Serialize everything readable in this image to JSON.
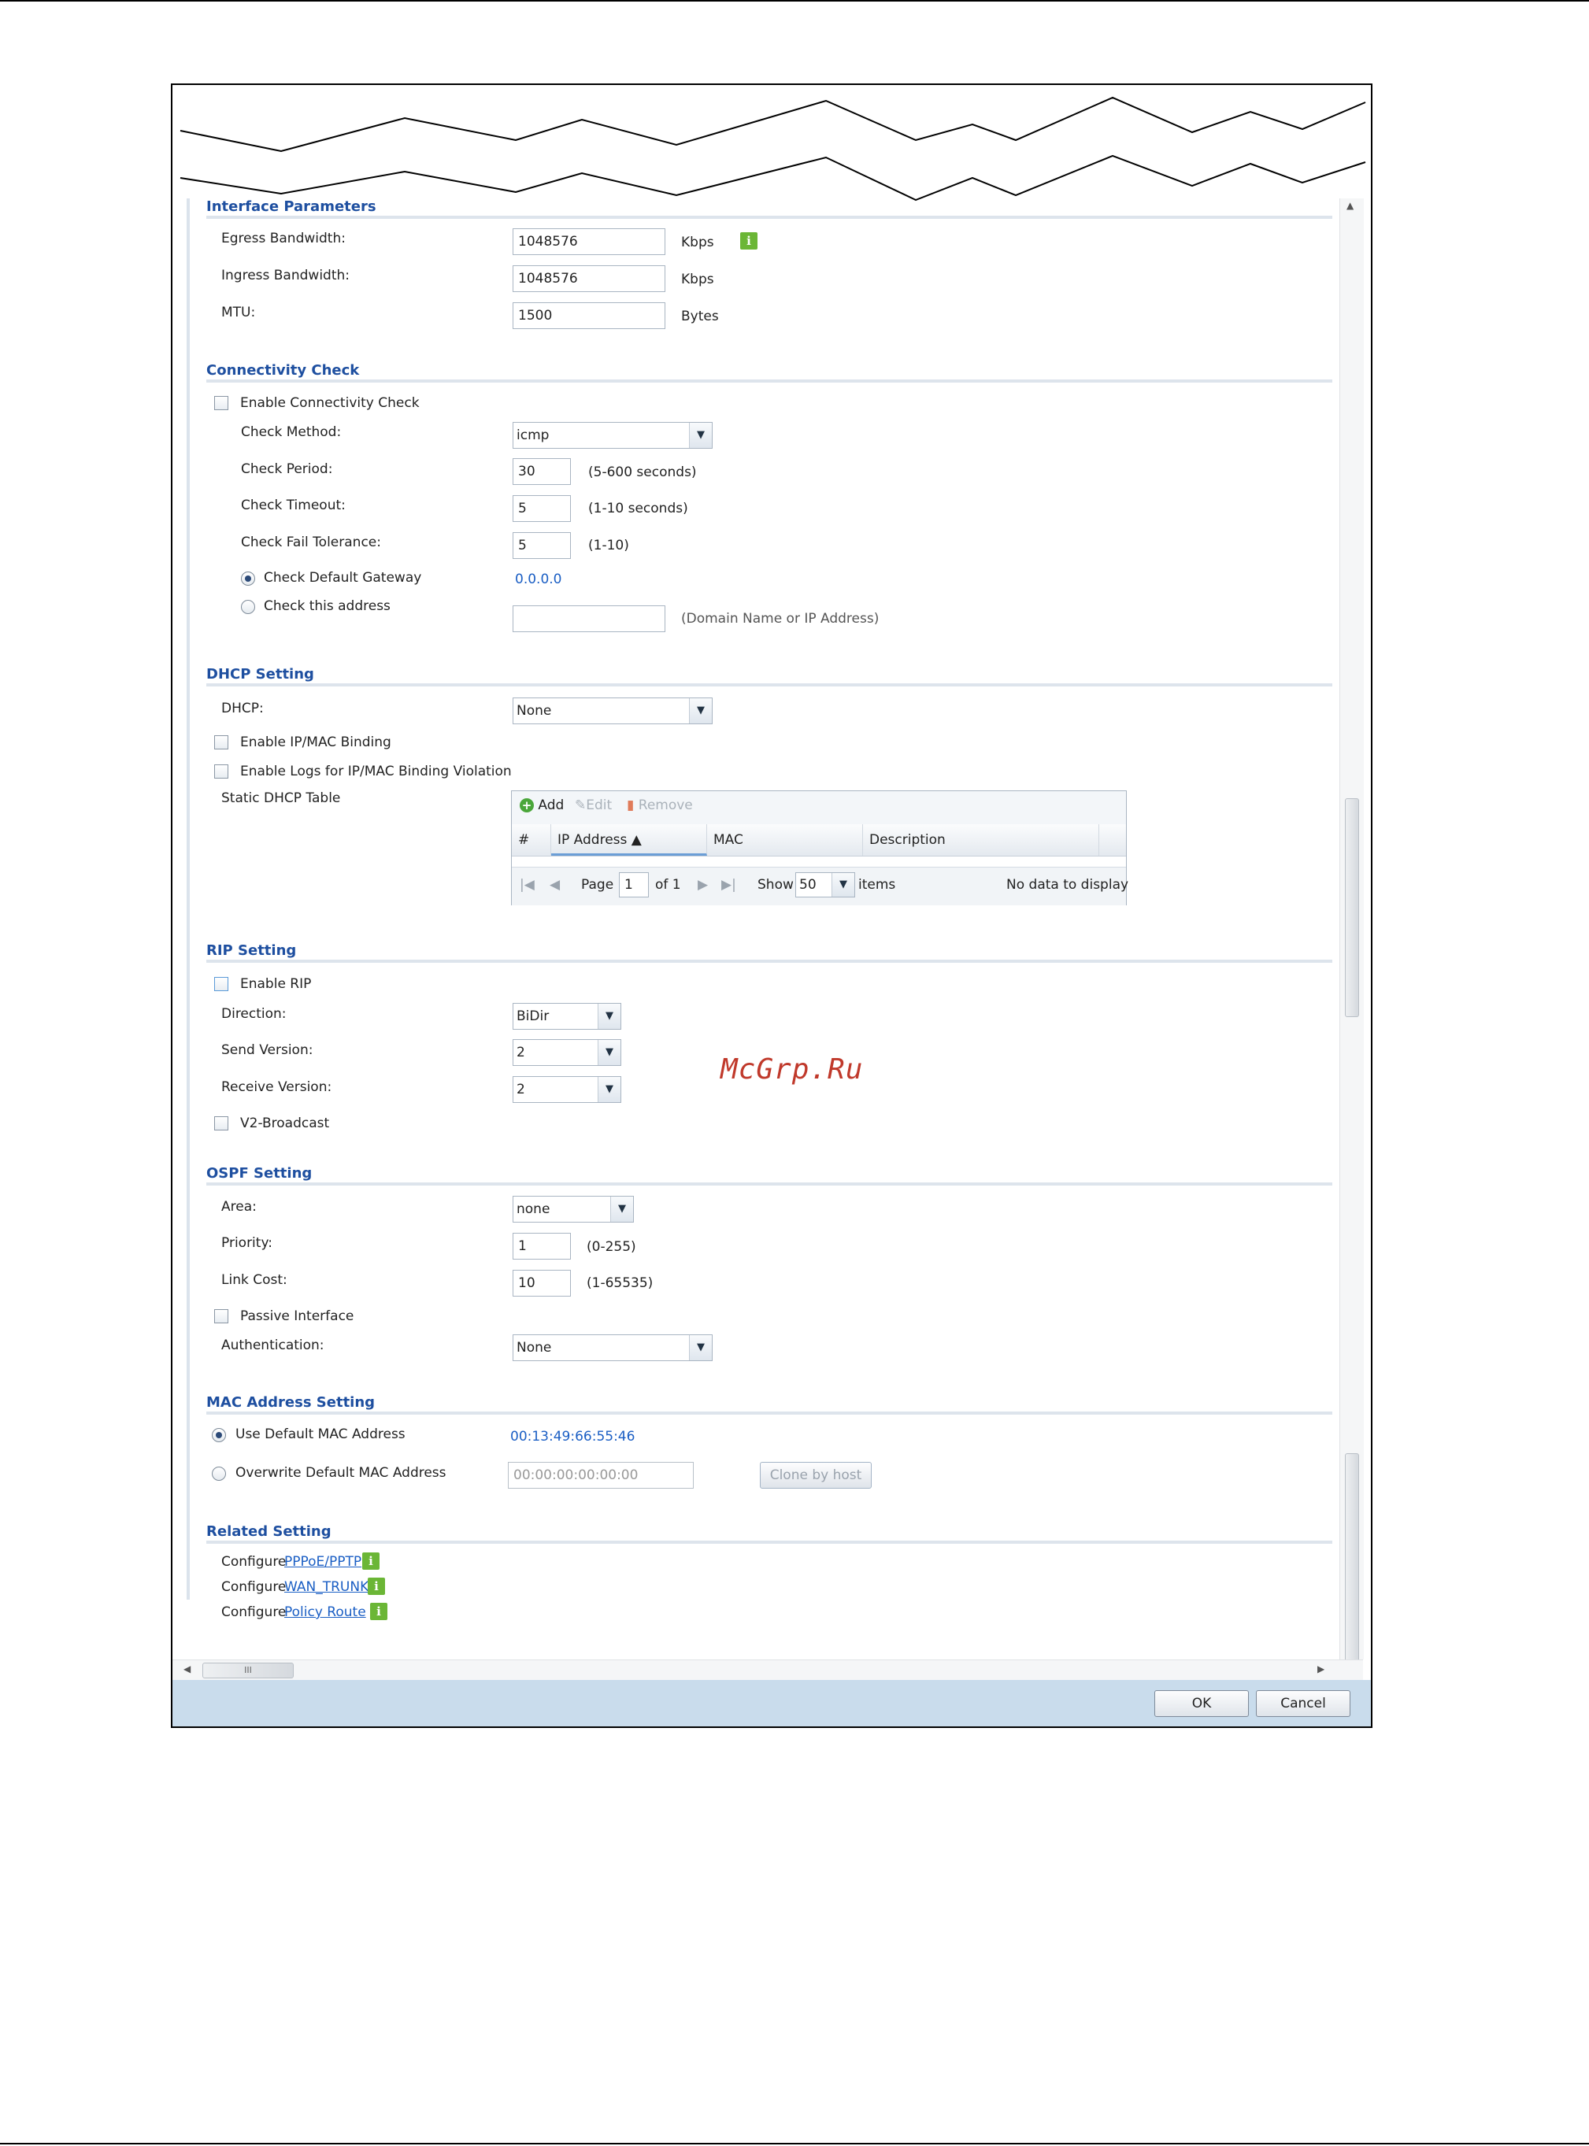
{
  "interface_parameters": {
    "title": "Interface Parameters",
    "egress_label": "Egress Bandwidth:",
    "egress_value": "1048576",
    "egress_unit": "Kbps",
    "ingress_label": "Ingress Bandwidth:",
    "ingress_value": "1048576",
    "ingress_unit": "Kbps",
    "mtu_label": "MTU:",
    "mtu_value": "1500",
    "mtu_unit": "Bytes"
  },
  "connectivity_check": {
    "title": "Connectivity Check",
    "enable_label": "Enable Connectivity Check",
    "method_label": "Check Method:",
    "method_value": "icmp",
    "period_label": "Check Period:",
    "period_value": "30",
    "period_hint": "(5-600 seconds)",
    "timeout_label": "Check Timeout:",
    "timeout_value": "5",
    "timeout_hint": "(1-10 seconds)",
    "fail_label": "Check Fail Tolerance:",
    "fail_value": "5",
    "fail_hint": "(1-10)",
    "default_gw_label": "Check Default Gateway",
    "default_gw_value": "0.0.0.0",
    "this_address_label": "Check this address",
    "this_address_hint": "(Domain Name or IP Address)"
  },
  "dhcp_setting": {
    "title": "DHCP Setting",
    "dhcp_label": "DHCP:",
    "dhcp_value": "None",
    "ipmac_label": "Enable IP/MAC Binding",
    "logs_label": "Enable Logs for IP/MAC Binding Violation",
    "static_table_label": "Static DHCP Table",
    "toolbar": {
      "add": "Add",
      "edit": "Edit",
      "remove": "Remove"
    },
    "columns": [
      "#",
      "IP Address ▲",
      "MAC",
      "Description"
    ],
    "pager": {
      "page_label": "Page",
      "page_value": "1",
      "of_label": "of 1",
      "show_label": "Show",
      "show_value": "50",
      "items_label": "items",
      "empty_text": "No data to display"
    }
  },
  "rip_setting": {
    "title": "RIP Setting",
    "enable_label": "Enable RIP",
    "direction_label": "Direction:",
    "direction_value": "BiDir",
    "send_label": "Send Version:",
    "send_value": "2",
    "receive_label": "Receive Version:",
    "receive_value": "2",
    "v2_label": "V2-Broadcast"
  },
  "ospf_setting": {
    "title": "OSPF Setting",
    "area_label": "Area:",
    "area_value": "none",
    "priority_label": "Priority:",
    "priority_value": "1",
    "priority_hint": "(0-255)",
    "cost_label": "Link Cost:",
    "cost_value": "10",
    "cost_hint": "(1-65535)",
    "passive_label": "Passive Interface",
    "auth_label": "Authentication:",
    "auth_value": "None"
  },
  "mac_setting": {
    "title": "MAC Address Setting",
    "default_label": "Use Default MAC Address",
    "default_value": "00:13:49:66:55:46",
    "overwrite_label": "Overwrite Default MAC Address",
    "overwrite_value": "00:00:00:00:00:00",
    "clone_label": "Clone by host"
  },
  "related_setting": {
    "title": "Related Setting",
    "items": [
      {
        "prefix": "Configure",
        "link": "PPPoE/PPTP"
      },
      {
        "prefix": "Configure",
        "link": "WAN_TRUNK"
      },
      {
        "prefix": "Configure",
        "link": "Policy Route"
      }
    ]
  },
  "footer": {
    "ok_label": "OK",
    "cancel_label": "Cancel"
  },
  "watermark": "McGrp.Ru",
  "scrollbar": {
    "hthumb_label": "III"
  }
}
